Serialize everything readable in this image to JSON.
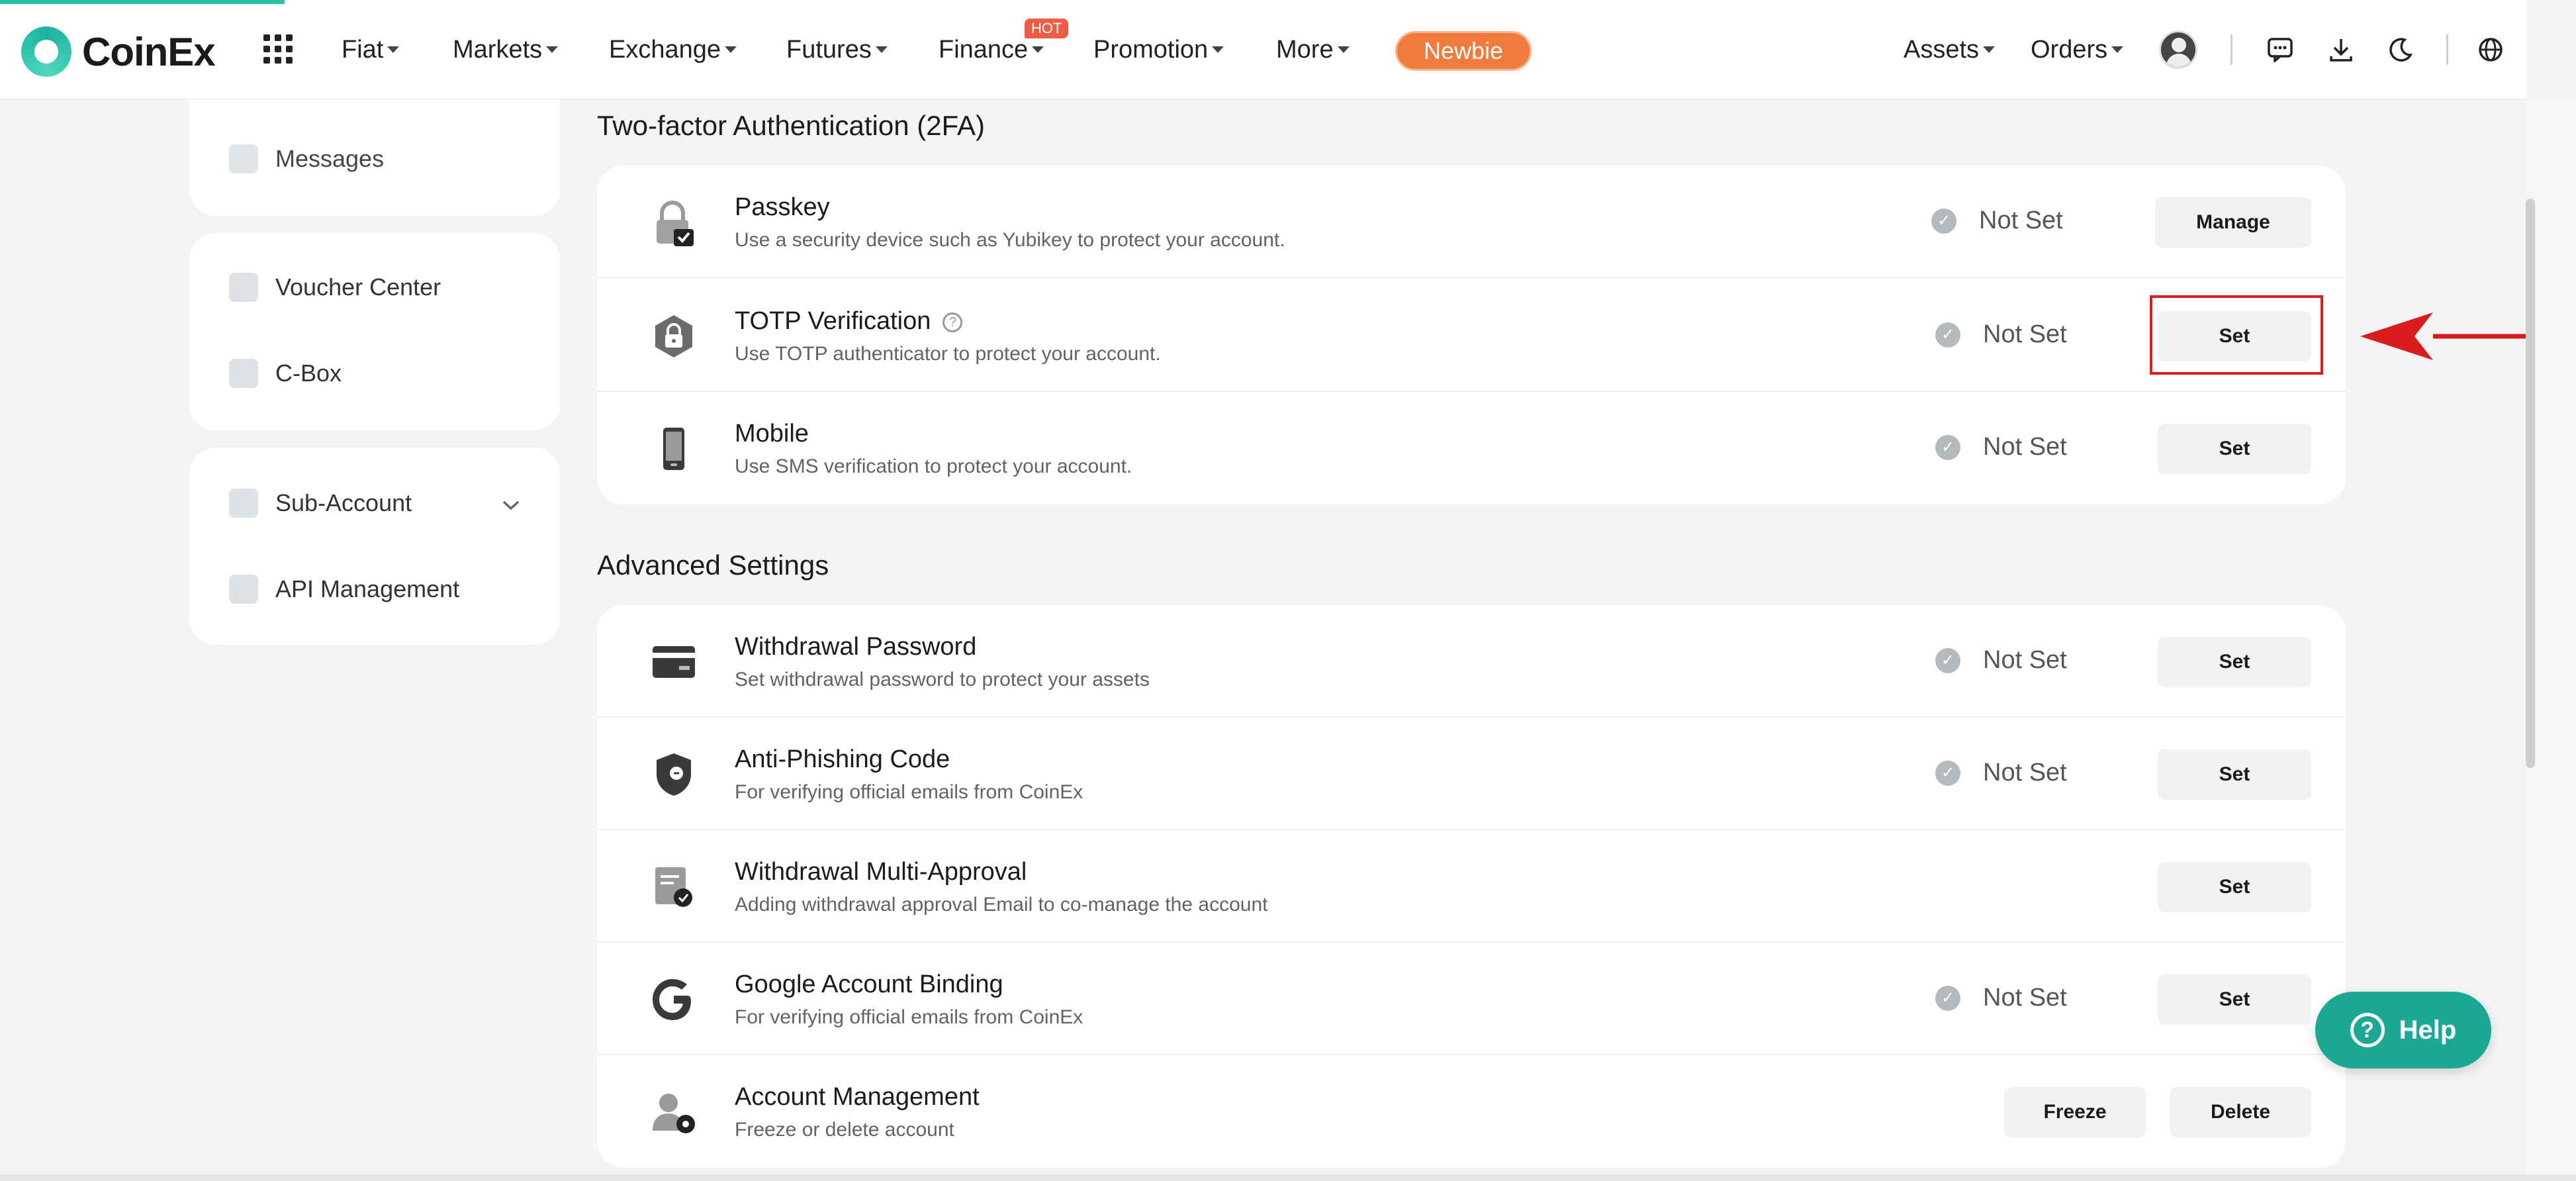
{
  "brand": {
    "name": "CoinEx"
  },
  "nav": {
    "items": [
      "Fiat",
      "Markets",
      "Exchange",
      "Futures",
      "Finance",
      "Promotion",
      "More"
    ],
    "hot_badge": "HOT",
    "newbie": "Newbie",
    "assets": "Assets",
    "orders": "Orders"
  },
  "sidebar": {
    "messages": "Messages",
    "voucher_center": "Voucher Center",
    "cbox": "C-Box",
    "sub_account": "Sub-Account",
    "api_management": "API Management"
  },
  "tfa": {
    "title": "Two-factor Authentication (2FA)",
    "rows": [
      {
        "title": "Passkey",
        "sub": "Use a security device such as Yubikey to protect your account.",
        "status": "Not Set",
        "action": "Manage"
      },
      {
        "title": "TOTP Verification",
        "sub": "Use TOTP authenticator to protect your account.",
        "status": "Not Set",
        "action": "Set"
      },
      {
        "title": "Mobile",
        "sub": "Use SMS verification to protect your account.",
        "status": "Not Set",
        "action": "Set"
      }
    ]
  },
  "advanced": {
    "title": "Advanced Settings",
    "rows": [
      {
        "title": "Withdrawal Password",
        "sub": "Set withdrawal password to protect your assets",
        "status": "Not Set",
        "action": "Set"
      },
      {
        "title": "Anti-Phishing Code",
        "sub": "For verifying official emails from CoinEx",
        "status": "Not Set",
        "action": "Set"
      },
      {
        "title": "Withdrawal Multi-Approval",
        "sub": "Adding withdrawal approval Email to co-manage the account",
        "action": "Set"
      },
      {
        "title": "Google Account Binding",
        "sub": "For verifying official emails from CoinEx",
        "status": "Not Set",
        "action": "Set"
      },
      {
        "title": "Account Management",
        "sub": "Freeze or delete account",
        "action_freeze": "Freeze",
        "action_delete": "Delete"
      }
    ]
  },
  "help": {
    "label": "Help"
  },
  "colors": {
    "accent": "#1ba894",
    "newbie": "#f07b3c",
    "highlight": "#d91c1c"
  }
}
